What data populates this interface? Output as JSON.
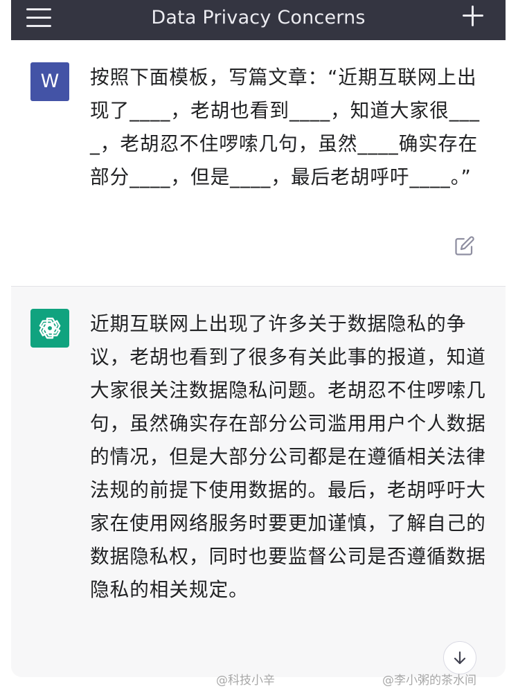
{
  "header": {
    "title": "Data Privacy Concerns",
    "menu_icon": "hamburger-menu-icon",
    "new_chat_icon": "plus-icon"
  },
  "user_message": {
    "avatar_letter": "W",
    "avatar_color": "#4353a6",
    "text": "按照下面模板，写篇文章：“近期互联网上出现了____，老胡也看到____，知道大家很____，老胡忍不住啰嗦几句，虽然____确实存在部分____，但是____，最后老胡呼吁____。”",
    "edit_icon": "edit-icon"
  },
  "assistant_message": {
    "avatar_icon": "openai-logo-icon",
    "avatar_color": "#10a37f",
    "text": "近期互联网上出现了许多关于数据隐私的争议，老胡也看到了很多有关此事的报道，知道大家很关注数据隐私问题。老胡忍不住啰嗦几句，虽然确实存在部分公司滥用用户个人数据的情况，但是大部分公司都是在遵循相关法律法规的前提下使用数据的。最后，老胡呼吁大家在使用网络服务时要更加谨慎，了解自己的数据隐私权，同时也要监督公司是否遵循数据隐私的相关规定。"
  },
  "scroll_button": {
    "icon": "arrow-down-icon"
  },
  "watermarks": {
    "left": "@科技小辛",
    "right": "@李小粥的茶水间"
  }
}
